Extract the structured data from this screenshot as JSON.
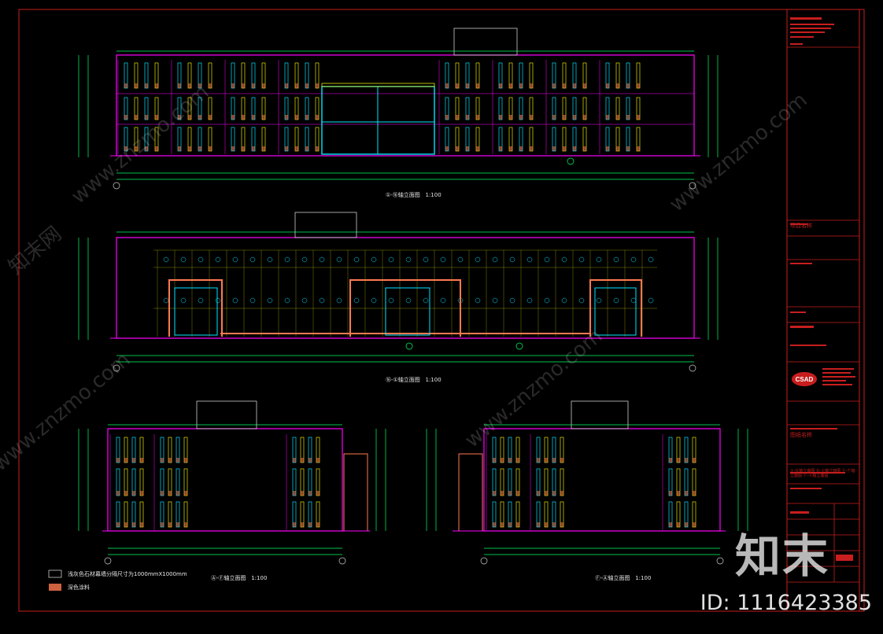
{
  "colors": {
    "frame": "#c81e1e",
    "facade_outline": "#ff00ff",
    "dimension": "#00ff66",
    "window_yellow": "#e6e600",
    "window_cyan": "#00e5ff",
    "hatch": "#ff7a50",
    "text": "#e6e6e6"
  },
  "drawings": [
    {
      "title": "①-⑯轴立面图",
      "scale": "1:100"
    },
    {
      "title": "⑯-①轴立面图",
      "scale": "1:100"
    },
    {
      "title": "Ⓐ-Ⓕ轴立面图",
      "scale": "1:100"
    },
    {
      "title": "Ⓕ-Ⓐ轴立面图",
      "scale": "1:100"
    }
  ],
  "legend": [
    {
      "text": "浅灰色石材幕墙分隔尺寸为1000mmX1000mm",
      "pattern": "outline"
    },
    {
      "text": "深色涂料",
      "pattern": "hatch"
    }
  ],
  "title_block": {
    "logo": "CSAD",
    "project_label": "项目名称",
    "drawing_label": "图纸名称",
    "drawing_name": "①-⑯轴立面图 ⑯-①轴立面图 Ⓐ-Ⓕ轴立面图 Ⓕ-Ⓐ轴立面图"
  },
  "watermark": {
    "site_text": "www.znzmo.com",
    "logo_text": "知末",
    "id_text": "ID: 1116423385"
  }
}
